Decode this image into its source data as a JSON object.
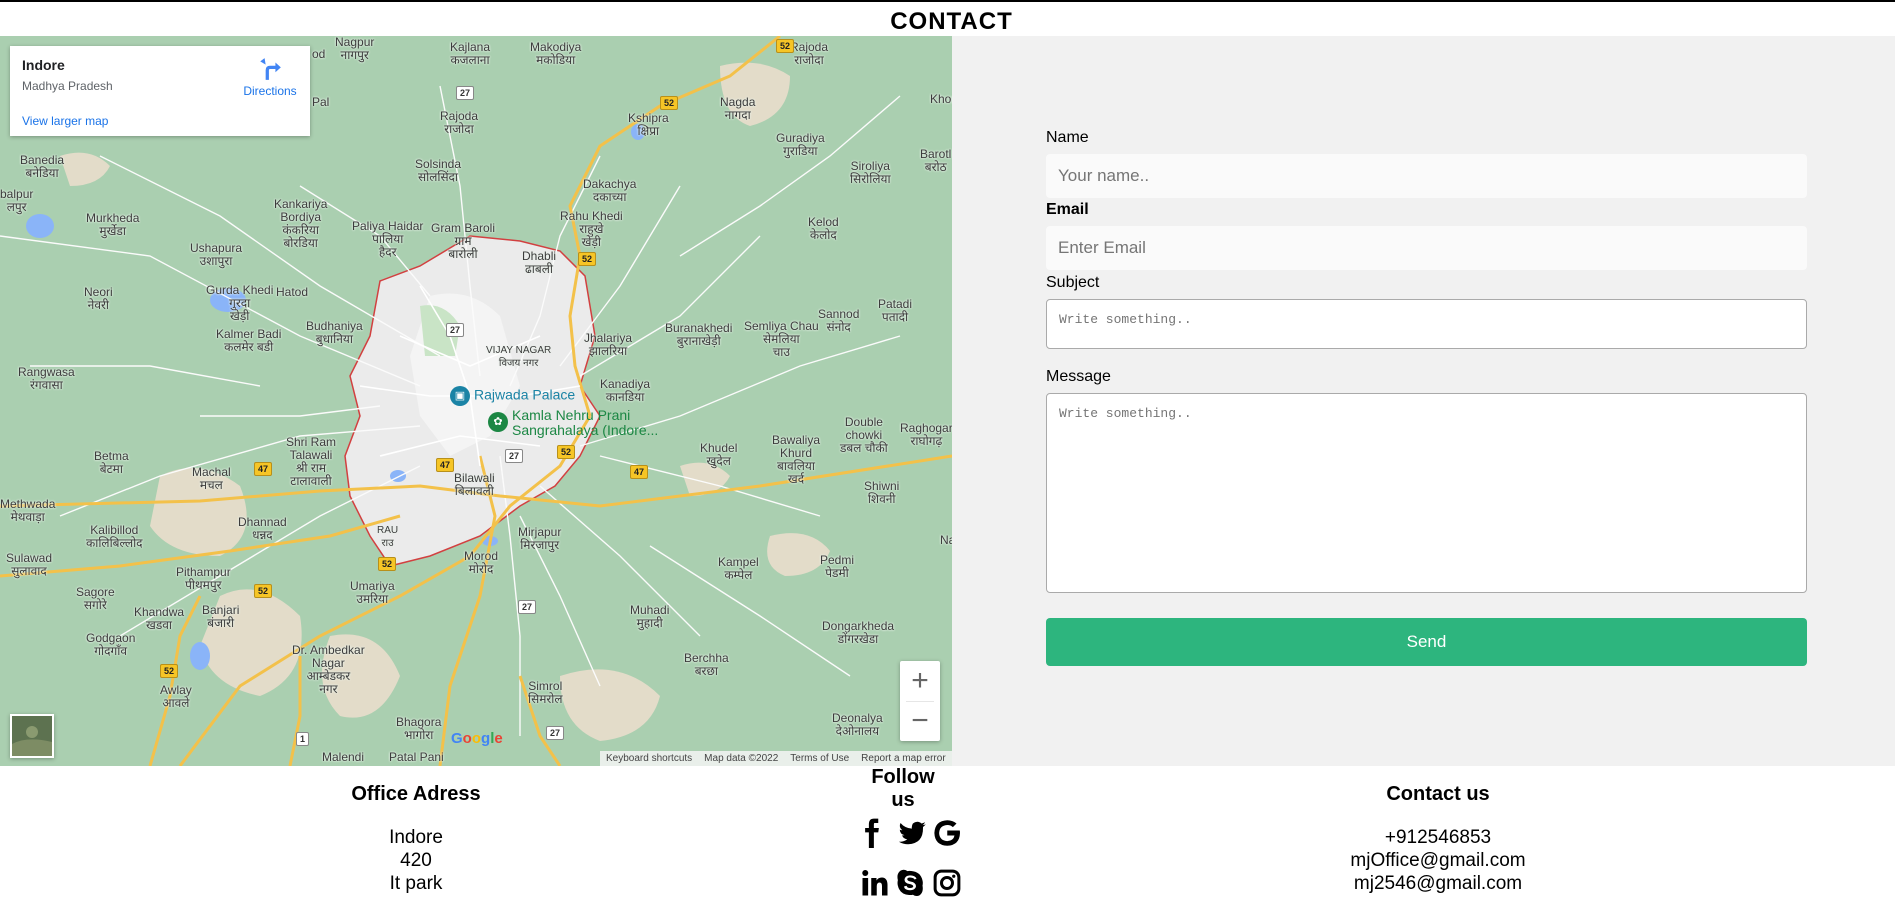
{
  "page": {
    "title": "CONTACT"
  },
  "map": {
    "info_title": "Indore",
    "info_subtitle": "Madhya Pradesh",
    "larger_map_link": "View larger map",
    "directions_label": "Directions",
    "zoom_in": "+",
    "zoom_out": "−",
    "google_logo": "Google",
    "attribution": [
      "Keyboard shortcuts",
      "Map data ©2022",
      "Terms of Use",
      "Report a map error"
    ],
    "poi_1": "Rajwada Palace",
    "poi_2_line1": "Kamla Nehru Prani",
    "poi_2_line2": "Sangrahalaya (Indore...",
    "places": {
      "kajlana": "Kajlana\nकजलाना",
      "makodiya": "Makodiya\nमकोडिया",
      "rajoda_ne": "Rajoda\nराजोदा",
      "pal": "a Pal",
      "kshipra": "Kshipra\nक्षिप्रा",
      "nagda": "Nagda\nनागदा",
      "rajoda": "Rajoda\nराजोदा",
      "guradiya": "Guradiya\nगुराडिया",
      "barotl": "Barotl\nबरोठ",
      "banedia": "Banedia\nबनेडिया",
      "solsinda": "Solsinda\nसोलसिंदा",
      "dakachya": "Dakachya\nदकाच्या",
      "siroliya": "Siroliya\nसिरोलिया",
      "balpur": "balpur\nलपुर",
      "murkheda": "Murkheda\nमुर्खेडा",
      "kankariya": "Kankariya\nBordiya\nकंकरिया\nबोरडिया",
      "paliya": "Paliya Haidar\nपालिया\nहैदर",
      "gram_baroli": "Gram Baroli\nग्राम\nबारोली",
      "rahu_khedi": "Rahu Khedi\nराहुखे\nखेड़ी",
      "kelod": "Kelod\nकेलोद",
      "ushapura": "Ushapura\nउशापुरा",
      "dhabli": "Dhabli\nढाबली",
      "neori": "Neori\nनेवरी",
      "gurda_khedi": "Gurda Khedi\nगुरदा\nखेड़ी",
      "hatod": "Hatod",
      "patadi": "Patadi\nपतादी",
      "sannod": "Sannod\nसंनोद",
      "semliya": "Semliya Chau\nसेमलिया\nचाउ",
      "buranakhedi": "Buranakhedi\nबुरानाखेड़ी",
      "budhaniya": "Budhaniya\nबुधानिया",
      "kalmer": "Kalmer Badi\nकलमेर बडी",
      "vijay_nagar": "VIJAY NAGAR\nविजय नगर",
      "jhalariya": "Jhalariya\nझालरिया",
      "rangwasa": "Rangwasa\nरंगवासा",
      "kanadiya": "Kanadiya\nकानडिया",
      "double_chowki": "Double\nchowki\nडबल चौकी",
      "raghogarh": "Raghogar\nराघोगढ़",
      "shri_ram": "Shri Ram\nTalawali\nश्री राम\nटालावाली",
      "khudel": "Khudel\nखुदेल",
      "bawaliya": "Bawaliya\nKhurd\nबावलिया\nखर्द",
      "betma": "Betma\nबेटमा",
      "machal": "Machal\nमचल",
      "bilawali": "Bilawali\nबिलावली",
      "shiwni": "Shiwni\nशिवनी",
      "methwada": "Methwada\nमेथवाड़ा",
      "dhannad": "Dhannad\nधन्नद",
      "rau": "RAU\nराउ",
      "mirjapur": "Mirjapur\nमिरजापुर",
      "kalibillod": "Kalibillod\nकालिबिल्लोद",
      "sulawad": "Sulawad\nसुलावाद",
      "morod": "Morod\nमोरोद",
      "kampel": "Kampel\nकम्पेल",
      "pedmi": "Pedmi\nपेडमी",
      "pithampur": "Pithampur\nपीथमपुर",
      "umariya": "Umariya\nउमरिया",
      "sagore": "Sagore\nसगोरे",
      "khandwa": "Khandwa\nखडवा",
      "banjari": "Banjari\nबंजारी",
      "muhadi": "Muhadi\nमुहादी",
      "dongarkheda": "Dongarkheda\nडोंगरखेडा",
      "godgaon": "Godgaon\nगोदगाँव",
      "ambedkar": "Dr. Ambedkar\nNagar\nआम्बेडकर\nनगर",
      "berchha": "Berchha\nबरछा",
      "awlay": "Awlay\nआवले",
      "simrol": "Simrol\nसिमरोल",
      "bhagora": "Bhagora\nभागोरा",
      "deonalya": "Deonalya\nदेओनालय",
      "malendi": "Malendi",
      "patal_pani": "Patal Pani",
      "nagpur": "Nagpur\nनागपुर",
      "khor": "Khor",
      "nod": "od",
      "na": "Na"
    },
    "shields": [
      "52",
      "27",
      "52",
      "52",
      "27",
      "47",
      "47",
      "27",
      "52",
      "47",
      "52",
      "27",
      "52",
      "1",
      "27",
      "52"
    ]
  },
  "form": {
    "name_label": "Name",
    "name_placeholder": "Your name..",
    "email_label": "Email",
    "email_placeholder": "Enter Email",
    "subject_label": "Subject",
    "subject_placeholder": "Write something..",
    "message_label": "Message",
    "message_placeholder": "Write something..",
    "send_label": "Send",
    "send_color": "#2db57e"
  },
  "footer": {
    "office": {
      "heading": "Office Adress",
      "line1": "Indore",
      "line2": "420",
      "line3": "It park"
    },
    "follow": {
      "heading": "Follow us",
      "icons": [
        "facebook-icon",
        "twitter-icon",
        "google-icon",
        "linkedin-icon",
        "skype-icon",
        "instagram-icon"
      ]
    },
    "contact": {
      "heading": "Contact us",
      "phone": "+912546853",
      "email1": "mjOffice@gmail.com",
      "email2": "mj2546@gmail.com"
    }
  }
}
